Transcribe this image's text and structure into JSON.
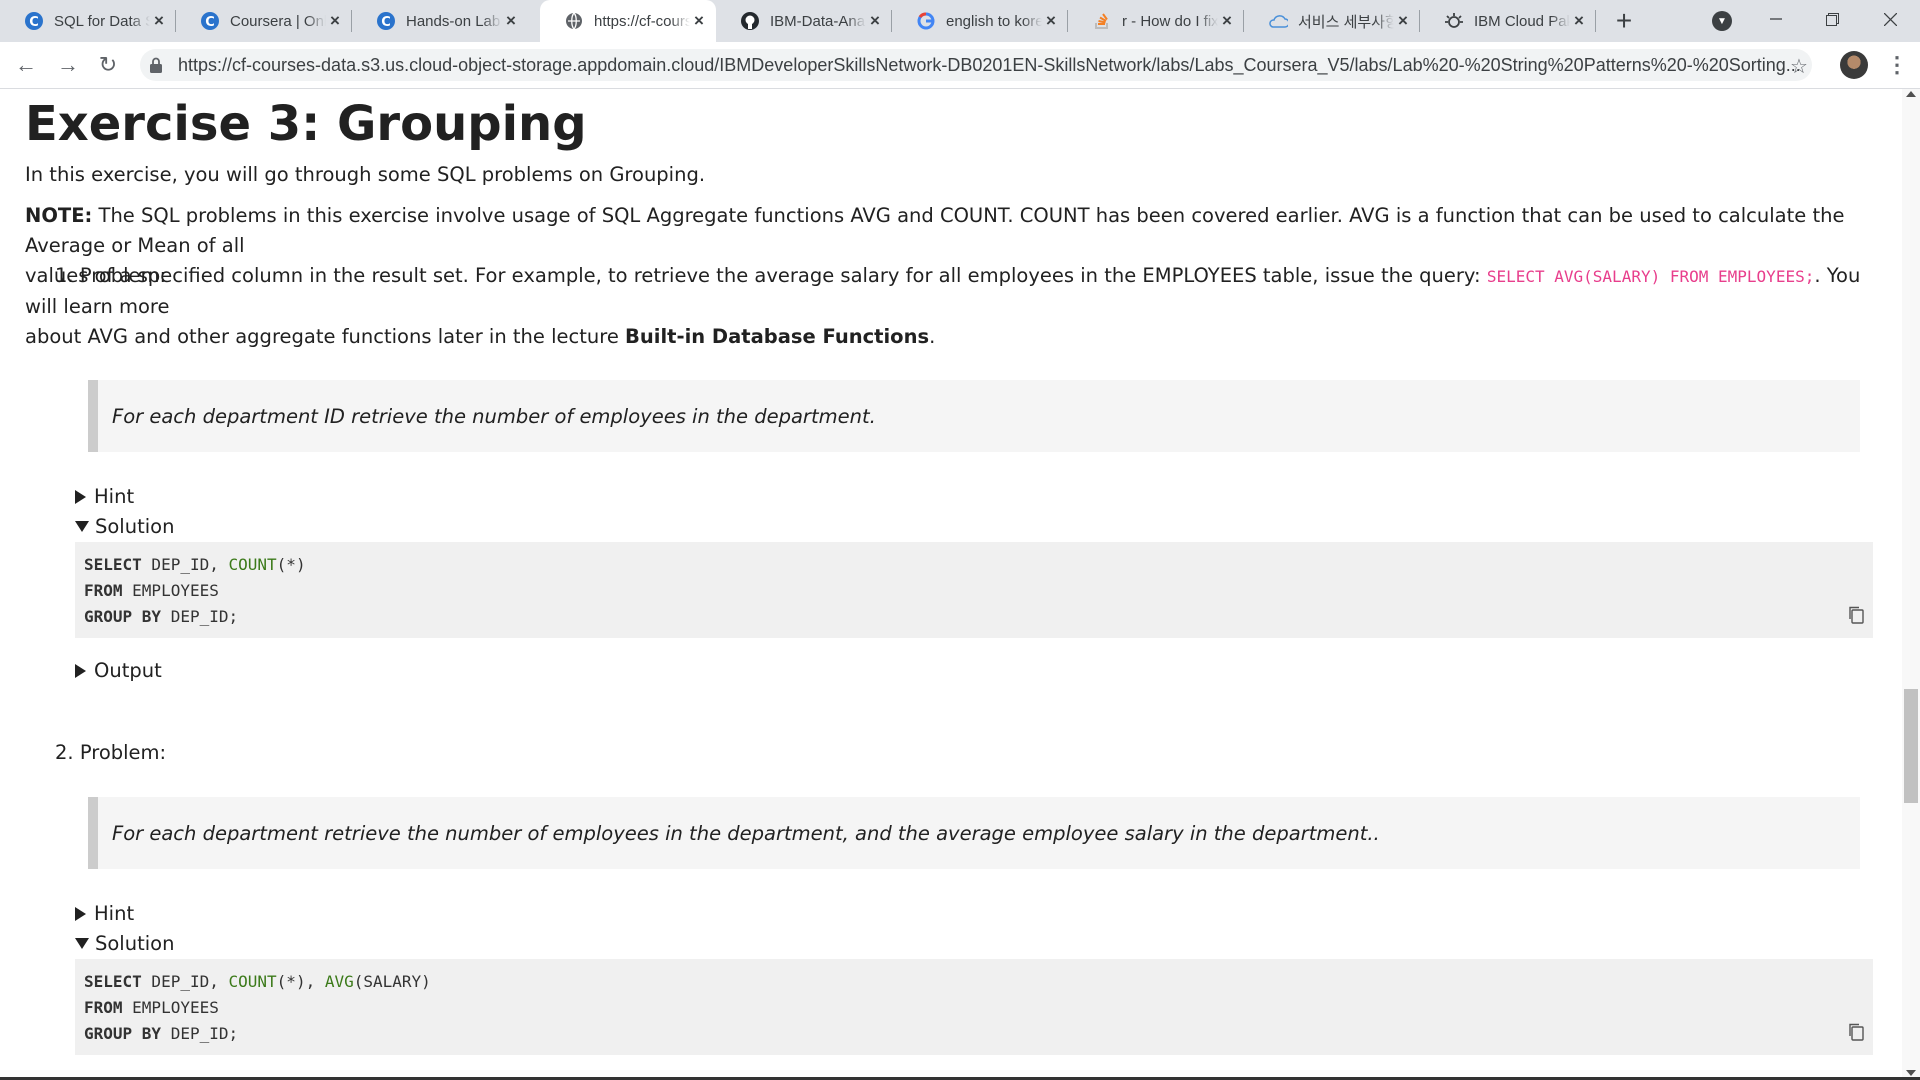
{
  "browser": {
    "tabs": [
      {
        "title": "SQL for Data Science",
        "favicon": "coursera-icon",
        "active": false
      },
      {
        "title": "Coursera | Online Courses",
        "favicon": "coursera-icon",
        "active": false
      },
      {
        "title": "Hands-on Lab",
        "favicon": "coursera-icon",
        "active": false
      },
      {
        "title": "https://cf-courses-data",
        "favicon": "globe-icon",
        "active": true
      },
      {
        "title": "IBM-Data-Analyst",
        "favicon": "github-icon",
        "active": false
      },
      {
        "title": "english to korean",
        "favicon": "google-icon",
        "active": false
      },
      {
        "title": "r - How do I fix",
        "favicon": "stackoverflow-icon",
        "active": false
      },
      {
        "title": "서비스 세부사항",
        "favicon": "cloud-icon",
        "active": false
      },
      {
        "title": "IBM Cloud Pak",
        "favicon": "ibm-cloud-icon",
        "active": false
      }
    ],
    "new_tab_label": "+",
    "url": "https://cf-courses-data.s3.us.cloud-object-storage.appdomain.cloud/IBMDeveloperSkillsNetwork-DB0201EN-SkillsNetwork/labs/Labs_Coursera_V5/labs/Lab%20-%20String%20Patterns%20-%20Sorting..."
  },
  "page": {
    "heading": "Exercise 3: Grouping",
    "intro": "In this exercise, you will go through some SQL problems on Grouping.",
    "note": {
      "label": "NOTE:",
      "text1": " The SQL problems in this exercise involve usage of SQL Aggregate functions AVG and COUNT. COUNT has been covered earlier. AVG is a function that can be used to calculate the Average or Mean of all",
      "text2": "values of a specified column in the result set. For example, to retrieve the average salary for all employees in the EMPLOYEES table, issue the query: ",
      "code": "SELECT AVG(SALARY) FROM EMPLOYEES;",
      "text3": ". You will learn more",
      "text4": "about AVG and other aggregate functions later in the lecture ",
      "bold": "Built-in Database Functions",
      "text5": "."
    },
    "problems": [
      {
        "number": "1.",
        "label": "Problem:",
        "quote": "For each department ID retrieve the number of employees in the department.",
        "hint": "Hint",
        "solution": "Solution",
        "output": "Output",
        "code": [
          [
            {
              "k": "SELECT",
              "t": "kw"
            },
            {
              "k": " DEP_ID, ",
              "t": "p"
            },
            {
              "k": "COUNT",
              "t": "fn"
            },
            {
              "k": "(*)",
              "t": "p"
            }
          ],
          [
            {
              "k": "FROM",
              "t": "kw"
            },
            {
              "k": " EMPLOYEES",
              "t": "p"
            }
          ],
          [
            {
              "k": "GROUP BY",
              "t": "kw"
            },
            {
              "k": " DEP_ID;",
              "t": "p"
            }
          ]
        ]
      },
      {
        "number": "2.",
        "label": "Problem:",
        "quote": "For each department retrieve the number of employees in the department, and the average employee salary in the department..",
        "hint": "Hint",
        "solution": "Solution",
        "code": [
          [
            {
              "k": "SELECT",
              "t": "kw"
            },
            {
              "k": " DEP_ID, ",
              "t": "p"
            },
            {
              "k": "COUNT",
              "t": "fn"
            },
            {
              "k": "(*), ",
              "t": "p"
            },
            {
              "k": "AVG",
              "t": "fn"
            },
            {
              "k": "(SALARY)",
              "t": "p"
            }
          ],
          [
            {
              "k": "FROM",
              "t": "kw"
            },
            {
              "k": " EMPLOYEES",
              "t": "p"
            }
          ],
          [
            {
              "k": "GROUP BY",
              "t": "kw"
            },
            {
              "k": " DEP_ID;",
              "t": "p"
            }
          ]
        ]
      }
    ]
  },
  "colors": {
    "inline_code": "#e83e8c",
    "code_function": "#3c7a1a",
    "quote_bg": "#f5f5f5",
    "code_bg": "#f0f0f0"
  }
}
